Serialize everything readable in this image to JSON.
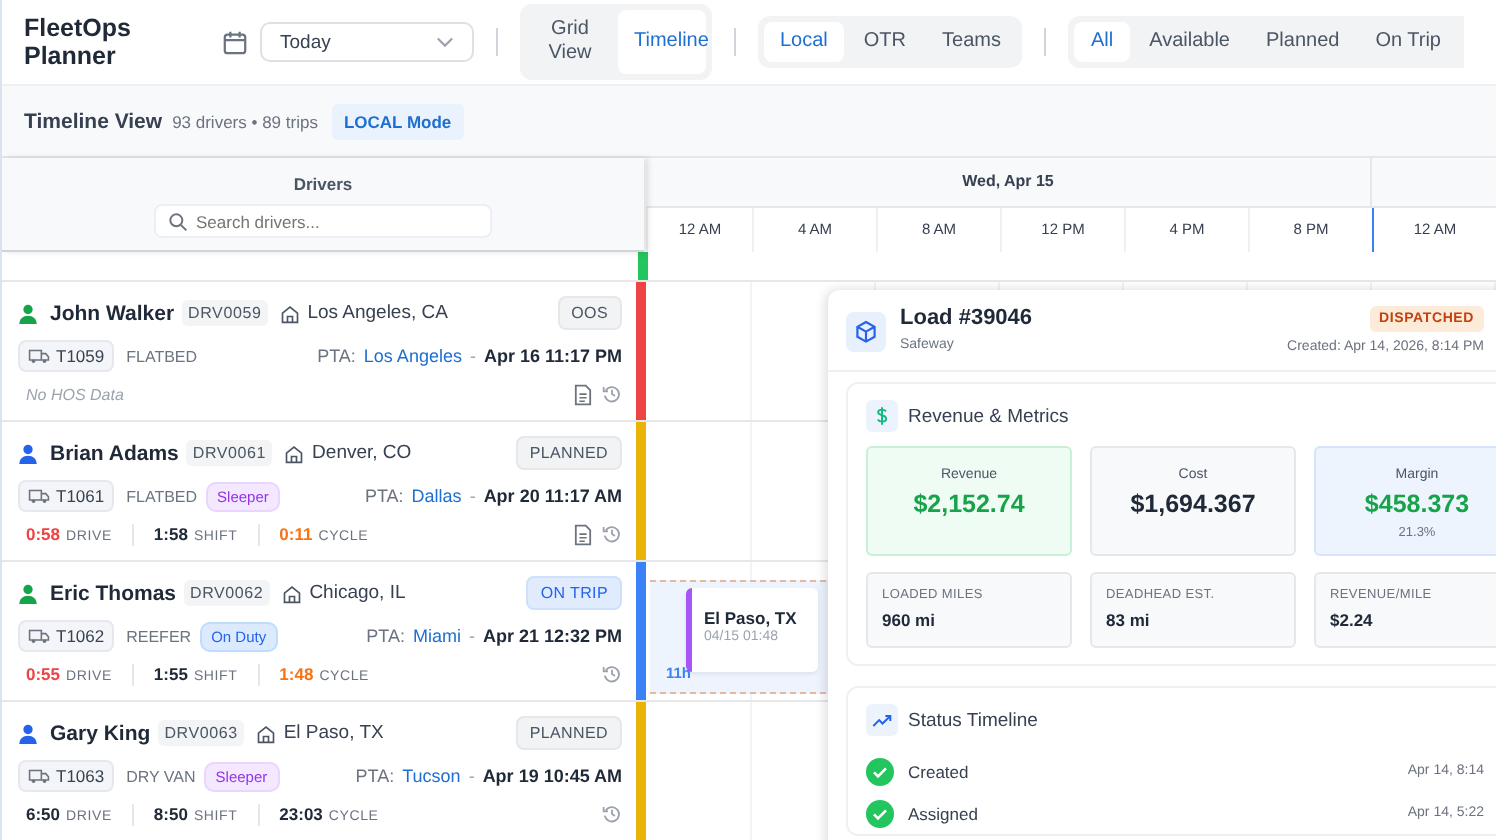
{
  "app": {
    "title": "FleetOps Planner"
  },
  "date_select": {
    "value": "Today"
  },
  "view_tabs": [
    {
      "label": "Grid View",
      "selected": false
    },
    {
      "label": "Timeline",
      "selected": true
    }
  ],
  "mode_tabs": [
    {
      "label": "Local",
      "selected": true
    },
    {
      "label": "OTR",
      "selected": false
    },
    {
      "label": "Teams",
      "selected": false
    }
  ],
  "status_filters": [
    {
      "label": "All",
      "selected": true
    },
    {
      "label": "Available",
      "selected": false
    },
    {
      "label": "Planned",
      "selected": false
    },
    {
      "label": "On Trip",
      "selected": false
    }
  ],
  "summary": {
    "title": "Timeline View",
    "counts": "93 drivers • 89 trips",
    "mode_badge": "LOCAL Mode"
  },
  "drivers_panel": {
    "title": "Drivers",
    "search": {
      "placeholder": "Search drivers..."
    }
  },
  "timeline": {
    "date": "Wed, Apr 15",
    "hours": [
      "12 AM",
      "4 AM",
      "8 AM",
      "12 PM",
      "4 PM",
      "8 PM",
      "12 AM"
    ]
  },
  "cut_off_row": {
    "color": "#22c55e"
  },
  "drivers": [
    {
      "name": "John Walker",
      "id": "DRV0059",
      "home": "Los Angeles, CA",
      "status": {
        "label": "OOS",
        "kind": "neutral"
      },
      "color": "#ef4444",
      "icon": {
        "color": "#16a34a"
      },
      "truck": "T1059",
      "equipment": "FLATBED",
      "pta_label": "PTA:",
      "pta_city": "Los Angeles",
      "pta_sep": "-",
      "pta_time": "Apr 16 11:17 PM",
      "hos_note": "No HOS Data",
      "has_document": true
    },
    {
      "name": "Brian Adams",
      "id": "DRV0061",
      "home": "Denver, CO",
      "status": {
        "label": "PLANNED",
        "kind": "neutral"
      },
      "color": "#eab308",
      "icon": {
        "color": "#2563eb"
      },
      "truck": "T1061",
      "equipment": "FLATBED",
      "duty": {
        "label": "Sleeper",
        "kind": "sleeper"
      },
      "pta_label": "PTA:",
      "pta_city": "Dallas",
      "pta_sep": "-",
      "pta_time": "Apr 20 11:17 AM",
      "hos": [
        {
          "value": "0:58",
          "label": "DRIVE",
          "color": "#ef4444"
        },
        {
          "value": "1:58",
          "label": "SHIFT",
          "color": "#1f2937"
        },
        {
          "value": "0:11",
          "label": "CYCLE",
          "color": "#f97316"
        }
      ],
      "has_document": true
    },
    {
      "name": "Eric Thomas",
      "id": "DRV0062",
      "home": "Chicago, IL",
      "status": {
        "label": "ON TRIP",
        "kind": "active"
      },
      "color": "#3b82f6",
      "icon": {
        "color": "#16a34a"
      },
      "truck": "T1062",
      "equipment": "REEFER",
      "duty": {
        "label": "On Duty",
        "kind": "on_duty"
      },
      "pta_label": "PTA:",
      "pta_city": "Miami",
      "pta_sep": "-",
      "pta_time": "Apr 21 12:32 PM",
      "hos": [
        {
          "value": "0:55",
          "label": "DRIVE",
          "color": "#ef4444"
        },
        {
          "value": "1:55",
          "label": "SHIFT",
          "color": "#1f2937"
        },
        {
          "value": "1:48",
          "label": "CYCLE",
          "color": "#f97316"
        }
      ],
      "has_document": false,
      "trip": {
        "city": "El Paso, TX",
        "time": "04/15 01:48",
        "duration": "11h"
      }
    },
    {
      "name": "Gary King",
      "id": "DRV0063",
      "home": "El Paso, TX",
      "status": {
        "label": "PLANNED",
        "kind": "neutral"
      },
      "color": "#eab308",
      "icon": {
        "color": "#2563eb"
      },
      "truck": "T1063",
      "equipment": "DRY VAN",
      "duty": {
        "label": "Sleeper",
        "kind": "sleeper"
      },
      "pta_label": "PTA:",
      "pta_city": "Tucson",
      "pta_sep": "-",
      "pta_time": "Apr 19 10:45 AM",
      "hos": [
        {
          "value": "6:50",
          "label": "DRIVE",
          "color": "#1f2937"
        },
        {
          "value": "8:50",
          "label": "SHIFT",
          "color": "#1f2937"
        },
        {
          "value": "23:03",
          "label": "CYCLE",
          "color": "#1f2937"
        }
      ],
      "has_document": false
    }
  ],
  "load_panel": {
    "title": "Load #39046",
    "customer": "Safeway",
    "status": "DISPATCHED",
    "created": "Created: Apr 14, 2026, 8:14 PM",
    "metrics_title": "Revenue & Metrics",
    "metrics": [
      {
        "label": "Revenue",
        "value": "$2,152.74",
        "kind": "revenue"
      },
      {
        "label": "Cost",
        "value": "$1,694.367",
        "kind": "cost"
      },
      {
        "label": "Margin",
        "value": "$458.373",
        "note": "21.3%",
        "kind": "margin"
      }
    ],
    "stats": [
      {
        "label": "LOADED MILES",
        "value": "960 mi"
      },
      {
        "label": "DEADHEAD EST.",
        "value": "83 mi"
      },
      {
        "label": "REVENUE/MILE",
        "value": "$2.24"
      }
    ],
    "timeline_title": "Status Timeline",
    "events": [
      {
        "label": "Created",
        "time": "Apr 14, 8:14",
        "done": true
      },
      {
        "label": "Assigned",
        "time": "Apr 14, 5:22",
        "done": true
      }
    ]
  }
}
